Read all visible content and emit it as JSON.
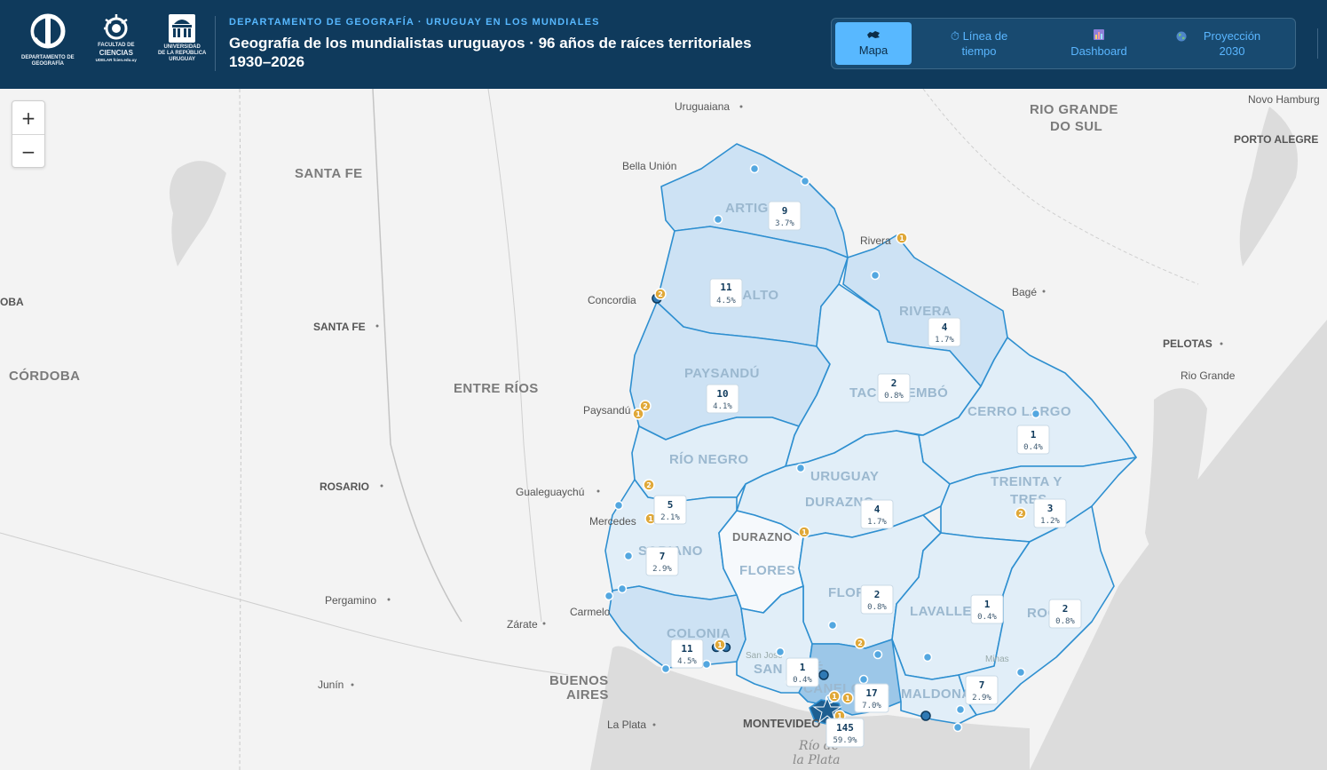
{
  "header": {
    "logos": {
      "geografia_lines": [
        "DEPARTAMENTO DE",
        "GEOGRAFÍA"
      ],
      "ciencias_lines": [
        "FACULTAD DE",
        "CIENCIAS",
        "UDELAR fcien.edu.uy"
      ],
      "udelar_lines": [
        "UNIVERSIDAD",
        "DE LA REPÚBLICA",
        "URUGUAY"
      ]
    },
    "kicker": "DEPARTAMENTO DE GEOGRAFÍA · URUGUAY EN LOS MUNDIALES",
    "title": "Geografía de los mundialistas uruguayos · 96 años de raíces territoriales 1930–2026"
  },
  "tabs": [
    {
      "icon": "map-icon",
      "label": "Mapa",
      "active": true
    },
    {
      "icon": "stopwatch-icon",
      "label": "⏱ Línea de tiempo",
      "active": false
    },
    {
      "icon": "chart-icon",
      "label": "Dashboard",
      "active": false
    },
    {
      "icon": "globe-icon",
      "label": "Proyección 2030",
      "active": false
    }
  ],
  "zoom": {
    "in": "+",
    "out": "−"
  },
  "map": {
    "colors": {
      "fill_light": "#e1eef8",
      "fill_mid": "#cde2f4",
      "fill_dark": "#9cc7e8",
      "border": "#2e8fd0",
      "capital": "#1e5f91",
      "dot": "#53a7e0",
      "marker": "#e0a838"
    },
    "outside_labels": [
      {
        "id": "uruguaiana",
        "text": "Uruguaiana"
      },
      {
        "id": "rio-grande-do-sul-1",
        "text": "RIO GRANDE"
      },
      {
        "id": "rio-grande-do-sul-2",
        "text": "DO SUL"
      },
      {
        "id": "novo-hamburgo",
        "text": "Novo Hamburg"
      },
      {
        "id": "porto-alegre",
        "text": "PORTO ALEGRE"
      },
      {
        "id": "santa-fe-region",
        "text": "SANTA FE"
      },
      {
        "id": "bella-union",
        "text": "Bella Unión"
      },
      {
        "id": "rivera-city",
        "text": "Rivera"
      },
      {
        "id": "concordia",
        "text": "Concordia"
      },
      {
        "id": "bage",
        "text": "Bagé"
      },
      {
        "id": "cordoba-edge",
        "text": "OBA"
      },
      {
        "id": "santa-fe-city",
        "text": "SANTA FE"
      },
      {
        "id": "pelotas",
        "text": "PELOTAS"
      },
      {
        "id": "cordoba",
        "text": "CÓRDOBA"
      },
      {
        "id": "entre-rios",
        "text": "ENTRE RÍOS"
      },
      {
        "id": "rio-grande-city",
        "text": "Rio Grande"
      },
      {
        "id": "paysandu-city",
        "text": "Paysandú"
      },
      {
        "id": "rosario",
        "text": "ROSARIO"
      },
      {
        "id": "gualeguaychu",
        "text": "Gualeguaychú"
      },
      {
        "id": "mercedes",
        "text": "Mercedes"
      },
      {
        "id": "pergamino",
        "text": "Pergamino"
      },
      {
        "id": "carmelo",
        "text": "Carmelo"
      },
      {
        "id": "zarate",
        "text": "Zárate"
      },
      {
        "id": "junin",
        "text": "Junín"
      },
      {
        "id": "buenos-aires-1",
        "text": "BUENOS"
      },
      {
        "id": "buenos-aires-2",
        "text": "AIRES"
      },
      {
        "id": "la-plata",
        "text": "La Plata"
      },
      {
        "id": "montevideo",
        "text": "MONTEVIDEO"
      },
      {
        "id": "san-jose-town",
        "text": "San José"
      },
      {
        "id": "rio-de-la-plata-1",
        "text": "Río de"
      },
      {
        "id": "rio-de-la-plata-2",
        "text": "la Plata"
      },
      {
        "id": "minas-town",
        "text": "Minas"
      }
    ],
    "department_labels": [
      {
        "id": "artigas",
        "text": "ARTIGAS"
      },
      {
        "id": "salto",
        "text": "SALTO"
      },
      {
        "id": "rivera",
        "text": "RIVERA"
      },
      {
        "id": "paysandu",
        "text": "PAYSANDÚ"
      },
      {
        "id": "tacuarembo",
        "text": "TACUAREMBÓ"
      },
      {
        "id": "cerro-largo",
        "text": "CERRO LARGO"
      },
      {
        "id": "rio-negro",
        "text": "RÍO NEGRO"
      },
      {
        "id": "durazno",
        "text": "DURAZNO"
      },
      {
        "id": "treinta-y-tres-1",
        "text": "TREINTA Y"
      },
      {
        "id": "treinta-y-tres-2",
        "text": "TRES"
      },
      {
        "id": "soriano",
        "text": "SORIANO"
      },
      {
        "id": "flores",
        "text": "FLORES"
      },
      {
        "id": "florida",
        "text": "FLORIDA"
      },
      {
        "id": "lavalleja",
        "text": "LAVALLEJA"
      },
      {
        "id": "rocha",
        "text": "ROCHA"
      },
      {
        "id": "colonia",
        "text": "COLONIA"
      },
      {
        "id": "san-jose",
        "text": "SAN JOSÉ"
      },
      {
        "id": "canelones",
        "text": "CANELONES"
      },
      {
        "id": "maldonado",
        "text": "MALDONADO"
      },
      {
        "id": "durazno-city",
        "text": "DURAZNO"
      },
      {
        "id": "uruguay-overlay",
        "text": "URUGUAY"
      }
    ],
    "badges": [
      {
        "dept": "artigas",
        "count": "9",
        "pct": "3.7%"
      },
      {
        "dept": "salto",
        "count": "11",
        "pct": "4.5%"
      },
      {
        "dept": "rivera",
        "count": "4",
        "pct": "1.7%"
      },
      {
        "dept": "tacuarembo",
        "count": "2",
        "pct": "0.8%"
      },
      {
        "dept": "paysandu",
        "count": "10",
        "pct": "4.1%"
      },
      {
        "dept": "cerro-largo",
        "count": "1",
        "pct": "0.4%"
      },
      {
        "dept": "rio-negro",
        "count": "5",
        "pct": "2.1%"
      },
      {
        "dept": "durazno",
        "count": "4",
        "pct": "1.7%"
      },
      {
        "dept": "treinta-y-tres",
        "count": "3",
        "pct": "1.2%"
      },
      {
        "dept": "soriano",
        "count": "7",
        "pct": "2.9%"
      },
      {
        "dept": "florida",
        "count": "2",
        "pct": "0.8%"
      },
      {
        "dept": "lavalleja",
        "count": "1",
        "pct": "0.4%"
      },
      {
        "dept": "rocha",
        "count": "2",
        "pct": "0.8%"
      },
      {
        "dept": "colonia",
        "count": "11",
        "pct": "4.5%"
      },
      {
        "dept": "san-jose",
        "count": "1",
        "pct": "0.4%"
      },
      {
        "dept": "canelones",
        "count": "17",
        "pct": "7.0%"
      },
      {
        "dept": "maldonado",
        "count": "7",
        "pct": "2.9%"
      },
      {
        "dept": "montevideo",
        "count": "145",
        "pct": "59.9%"
      }
    ],
    "markers": [
      {
        "id": "rivera",
        "text": "1"
      },
      {
        "id": "concordia",
        "text": "2"
      },
      {
        "id": "paysandu-a",
        "text": "2"
      },
      {
        "id": "paysandu-b",
        "text": "1"
      },
      {
        "id": "rio-negro-a",
        "text": "2"
      },
      {
        "id": "rio-negro-b",
        "text": "1"
      },
      {
        "id": "durazno",
        "text": "1"
      },
      {
        "id": "treinta-y-tres",
        "text": "2"
      },
      {
        "id": "colonia",
        "text": "1"
      },
      {
        "id": "canelones",
        "text": "2"
      },
      {
        "id": "montevideo-a",
        "text": "1"
      },
      {
        "id": "montevideo-b",
        "text": "1"
      },
      {
        "id": "montevideo-c",
        "text": "1"
      }
    ]
  }
}
